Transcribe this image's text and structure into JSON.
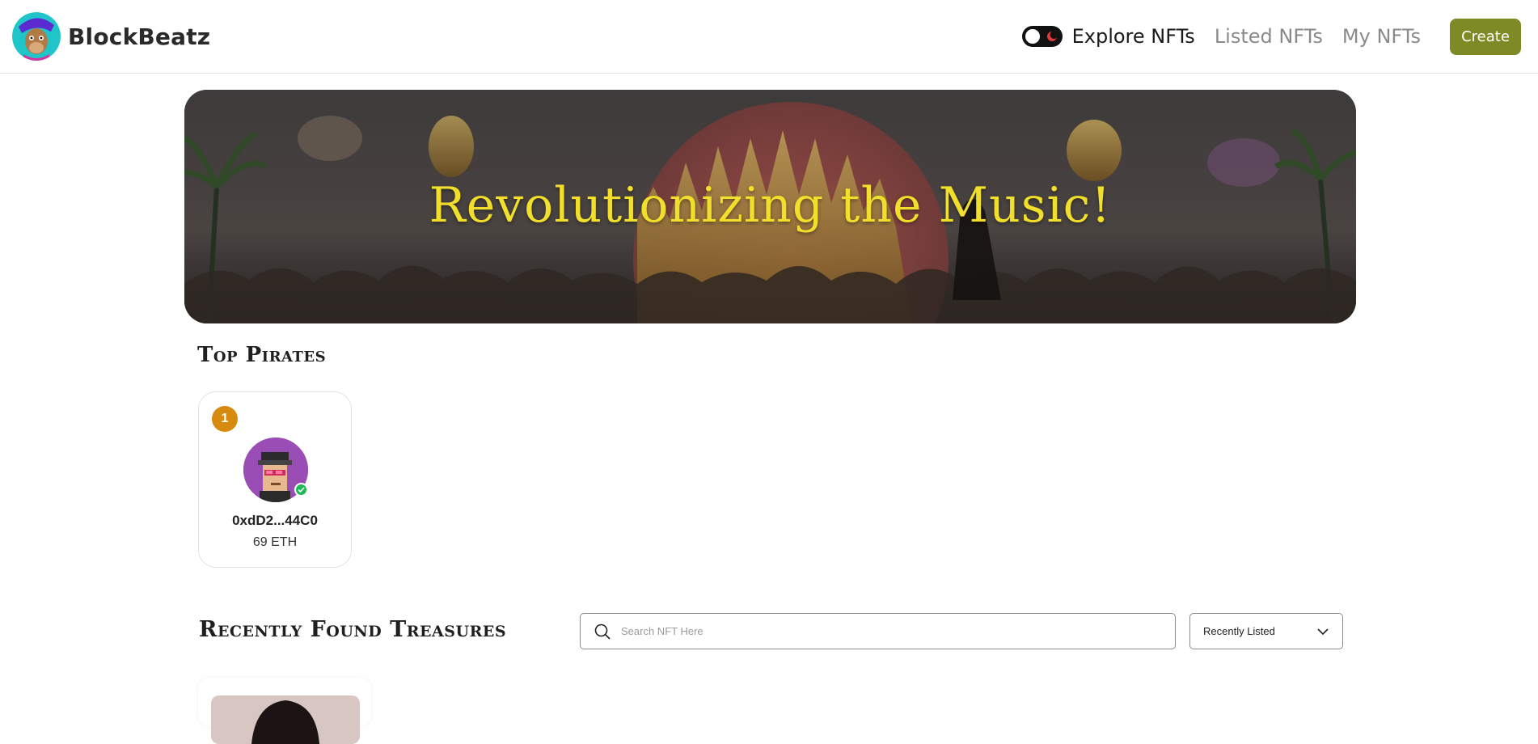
{
  "navbar": {
    "brand": "BlockBeatz",
    "links": [
      {
        "label": "Explore NFTs",
        "active": true
      },
      {
        "label": "Listed NFTs",
        "active": false
      },
      {
        "label": "My NFTs",
        "active": false
      }
    ],
    "create_label": "Create",
    "toggle_icon": "moon-icon"
  },
  "hero": {
    "title": "Revolutionizing the Music!"
  },
  "top_pirates": {
    "title": "Top Pirates",
    "cards": [
      {
        "rank": "1",
        "address": "0xdD2...44C0",
        "amount": "69 ETH"
      }
    ]
  },
  "recent": {
    "title": "Recently Found Treasures",
    "search_placeholder": "Search NFT Here",
    "sort_selected": "Recently Listed"
  },
  "colors": {
    "accent": "#7e8a25",
    "hero_title": "#f2df2b",
    "rank_badge": "#d68a0e",
    "verified": "#1db954"
  }
}
